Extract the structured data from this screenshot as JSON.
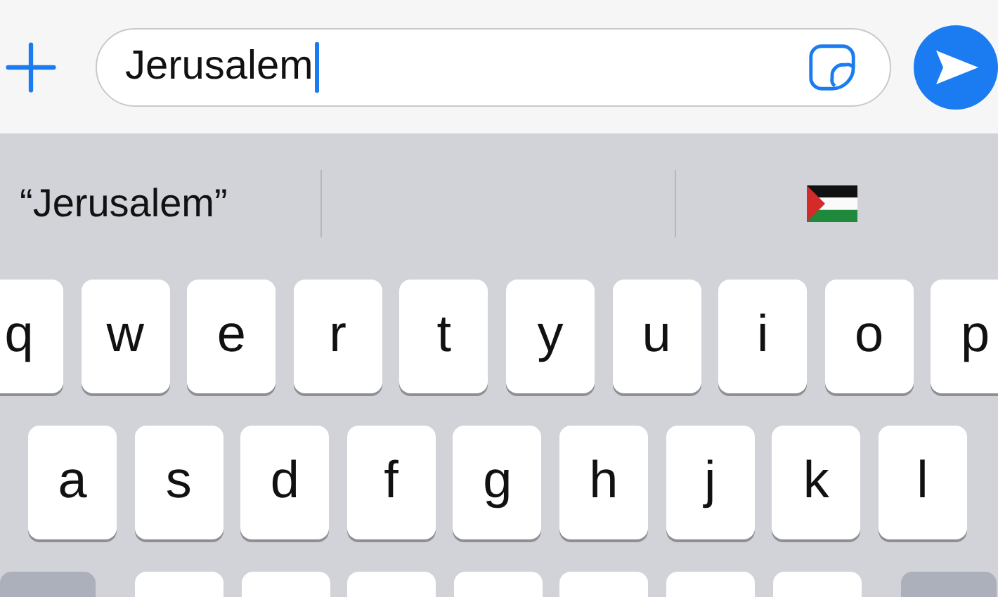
{
  "message_field": {
    "value": "Jerusalem"
  },
  "suggestions": [
    {
      "kind": "text",
      "label": "“Jerusalem”"
    },
    {
      "kind": "empty"
    },
    {
      "kind": "flag"
    }
  ],
  "key_rows": [
    [
      "q",
      "w",
      "e",
      "r",
      "t",
      "y",
      "u",
      "i",
      "o",
      "p"
    ],
    [
      "a",
      "s",
      "d",
      "f",
      "g",
      "h",
      "j",
      "k",
      "l"
    ]
  ],
  "bottom_row": [
    {
      "kind": "shift"
    },
    {
      "kind": "letter"
    },
    {
      "kind": "letter"
    },
    {
      "kind": "letter"
    },
    {
      "kind": "letter"
    },
    {
      "kind": "letter"
    },
    {
      "kind": "letter"
    },
    {
      "kind": "letter"
    },
    {
      "kind": "delete"
    }
  ]
}
